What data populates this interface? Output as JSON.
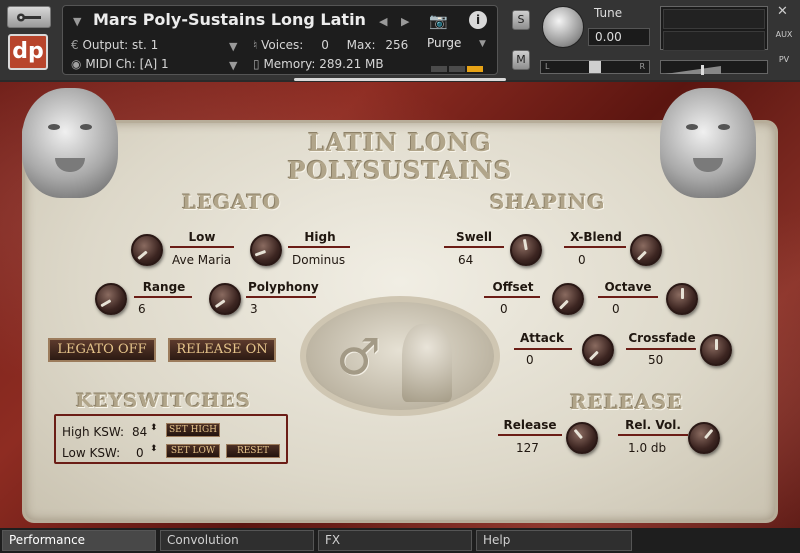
{
  "header": {
    "instrument_name": "Mars Poly-Sustains Long Latin",
    "output_label": "Output:",
    "output_value": "st. 1",
    "voices_label": "Voices:",
    "voices_value": "0",
    "max_label": "Max:",
    "max_value": "256",
    "purge_label": "Purge",
    "midi_label": "MIDI Ch:",
    "midi_value": "[A] 1",
    "memory_label": "Memory:",
    "memory_value": "289.21 MB",
    "s_label": "S",
    "m_label": "M",
    "tune_label": "Tune",
    "tune_value": "0.00",
    "pan_left": "L",
    "pan_right": "R",
    "aux_label": "AUX",
    "pv_label": "PV",
    "logo_text": "dp",
    "purge_meter_active_index": 2
  },
  "panel": {
    "title_line1": "LATIN LONG",
    "title_line2": "POLYSUSTAINS",
    "legato_heading": "LEGATO",
    "shaping_heading": "SHAPING",
    "keyswitches_heading": "KEYSWITCHES",
    "release_heading": "RELEASE"
  },
  "legato": {
    "low_label": "Low",
    "low_value": "Ave Maria",
    "high_label": "High",
    "high_value": "Dominus",
    "range_label": "Range",
    "range_value": "6",
    "polyphony_label": "Polyphony",
    "polyphony_value": "3",
    "legato_button": "LEGATO OFF",
    "release_button": "RELEASE ON"
  },
  "shaping": {
    "swell_label": "Swell",
    "swell_value": "64",
    "xblend_label": "X-Blend",
    "xblend_value": "0",
    "offset_label": "Offset",
    "offset_value": "0",
    "octave_label": "Octave",
    "octave_value": "0",
    "attack_label": "Attack",
    "attack_value": "0",
    "crossfade_label": "Crossfade",
    "crossfade_value": "50"
  },
  "keyswitches": {
    "high_label": "High KSW:",
    "high_value": "84",
    "low_label": "Low KSW:",
    "low_value": "0",
    "set_high": "SET HIGH",
    "set_low": "SET LOW",
    "reset": "RESET"
  },
  "release": {
    "release_label": "Release",
    "release_value": "127",
    "relvol_label": "Rel. Vol.",
    "relvol_value": "1.0 db"
  },
  "tabs": [
    "Performance",
    "Convolution",
    "FX",
    "Help"
  ],
  "colors": {
    "accent": "#e7a316",
    "marble_red": "#7a2118",
    "button_text": "#e6c58b"
  }
}
